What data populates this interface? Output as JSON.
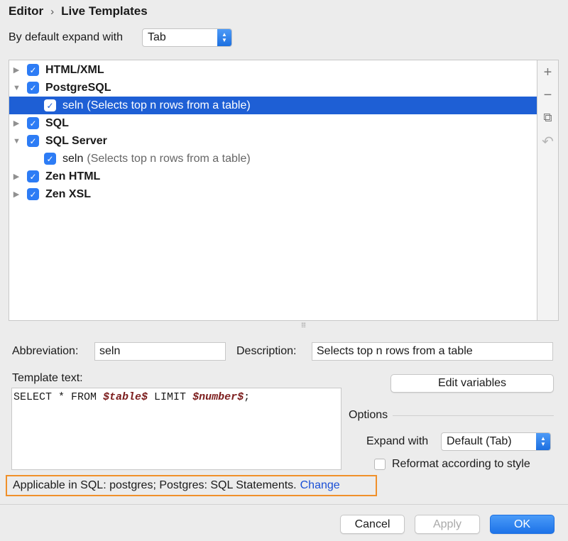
{
  "breadcrumb": {
    "parent": "Editor",
    "separator": "›",
    "current": "Live Templates"
  },
  "expand_default": {
    "label": "By default expand with",
    "value": "Tab"
  },
  "tree": {
    "rows": [
      {
        "kind": "group",
        "expanded": false,
        "checked": true,
        "name": "HTML/XML"
      },
      {
        "kind": "group",
        "expanded": true,
        "checked": true,
        "name": "PostgreSQL"
      },
      {
        "kind": "template",
        "checked": true,
        "selected": true,
        "name": "seln",
        "desc": "(Selects top n rows from a table)"
      },
      {
        "kind": "group",
        "expanded": false,
        "checked": true,
        "name": "SQL"
      },
      {
        "kind": "group",
        "expanded": true,
        "checked": true,
        "name": "SQL Server"
      },
      {
        "kind": "template",
        "checked": true,
        "selected": false,
        "name": "seln",
        "desc": "(Selects top n rows from a table)"
      },
      {
        "kind": "group",
        "expanded": false,
        "checked": true,
        "name": "Zen HTML"
      },
      {
        "kind": "group",
        "expanded": false,
        "checked": true,
        "name": "Zen XSL"
      }
    ]
  },
  "tools": {
    "add": "+",
    "remove": "−",
    "copy": "⧉",
    "restore": "↶"
  },
  "abbreviation": {
    "label": "Abbreviation:",
    "value": "seln"
  },
  "description": {
    "label": "Description:",
    "value": "Selects top n rows from a table"
  },
  "template_text": {
    "label": "Template text:",
    "parts": [
      "SELECT * FROM ",
      "$table$",
      " LIMIT ",
      "$number$",
      ";"
    ]
  },
  "edit_variables": "Edit variables",
  "options": {
    "title": "Options",
    "expand_with_label": "Expand with",
    "expand_with_value": "Default (Tab)",
    "reformat_label": "Reformat according to style",
    "reformat_checked": false
  },
  "applicable": {
    "text": "Applicable in SQL: postgres; Postgres: SQL Statements.",
    "link": "Change"
  },
  "footer": {
    "cancel": "Cancel",
    "apply": "Apply",
    "ok": "OK"
  },
  "colors": {
    "selection": "#1e5fd5",
    "checkbox": "#2d7cf5",
    "highlight_border": "#f0902a",
    "link": "#1a4fd6"
  }
}
